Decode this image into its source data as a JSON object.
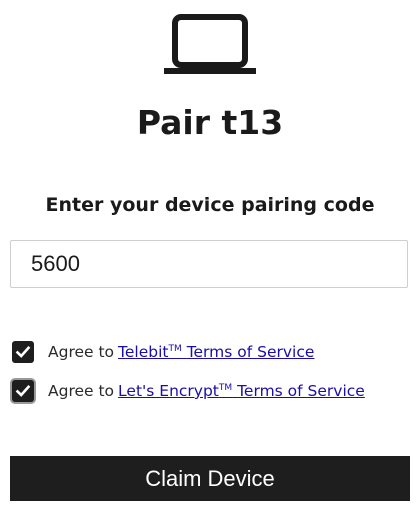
{
  "header": {
    "icon": "laptop-icon",
    "title": "Pair t13"
  },
  "form": {
    "prompt": "Enter your device pairing code",
    "code_value": "5600",
    "agreements": [
      {
        "checked": true,
        "prefix": "Agree to",
        "link_brand": "Telebit",
        "trademark": "TM",
        "link_suffix": "Terms of Service"
      },
      {
        "checked": true,
        "prefix": "Agree to",
        "link_brand": "Let's Encrypt",
        "trademark": "TM",
        "link_suffix": "Terms of Service"
      }
    ],
    "submit_label": "Claim Device"
  },
  "colors": {
    "text": "#1a1a1a",
    "link": "#1a0dab",
    "button_bg": "#1e1e1e",
    "button_text": "#ffffff",
    "input_border": "#cfcfcf"
  }
}
